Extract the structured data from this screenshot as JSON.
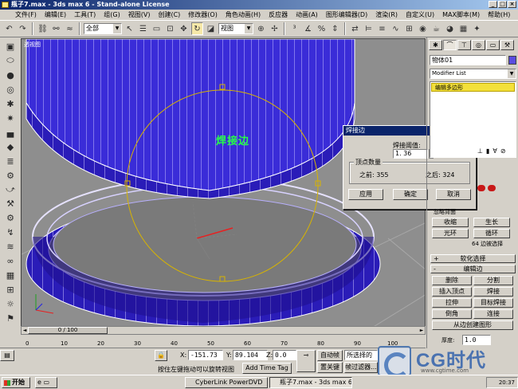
{
  "window": {
    "title": "瓶子7.max - 3ds max 6 - Stand-alone License",
    "buttons": [
      "_",
      "□",
      "×"
    ]
  },
  "menu": [
    "文件(F)",
    "编辑(E)",
    "工具(T)",
    "组(G)",
    "视图(V)",
    "创建(C)",
    "修改器(O)",
    "角色动画(H)",
    "反应器",
    "动画(A)",
    "图形编辑器(D)",
    "渲染(R)",
    "自定义(U)",
    "MAX脚本(M)",
    "帮助(H)"
  ],
  "toolbar": {
    "selection_filter": "全部",
    "coord_system": "视图"
  },
  "viewport": {
    "label": "透视图",
    "weld_label": "焊接边"
  },
  "weld_dialog": {
    "title": "焊接边",
    "threshold_label": "焊接阈值:",
    "threshold_value": "1. 36",
    "group_title": "顶点数量",
    "before": "之前: 355",
    "after": "之后: 324",
    "apply": "应用",
    "ok": "确定",
    "cancel": "取消"
  },
  "command_panel": {
    "object_name": "物体01",
    "modifier_list": "Modifier List",
    "stack_item": "编辑多边形",
    "object_color": "#5a4ce0",
    "partial_label": "忽略背面",
    "btn_shrink": "收缩",
    "btn_grow": "生长",
    "btn_ring": "光环",
    "btn_loop": "循环",
    "sel_info": "64 边被选择",
    "soft_sel": "软化选择",
    "edit_edges": "编辑边",
    "btn_remove": "删除",
    "btn_split": "分割",
    "btn_insert_vertex": "插入顶点",
    "btn_weld": "焊接",
    "btn_extrude": "拉伸",
    "btn_target_weld": "目标焊接",
    "btn_chamfer": "倒角",
    "btn_connect": "连接",
    "btn_create_shape": "从边创建图形",
    "thickness_label": "厚度:",
    "thickness_value": "1.0"
  },
  "timeline": {
    "position": "0 / 100",
    "ticks": [
      "0",
      "10",
      "20",
      "30",
      "40",
      "50",
      "60",
      "70",
      "80",
      "90",
      "100"
    ]
  },
  "status": {
    "x_label": "X:",
    "x_value": "-151.73",
    "y_label": "Y:",
    "y_value": "89.104",
    "z_label": "Z:",
    "z_value": "0.0",
    "hint": "按住左键拖动可以旋转视图",
    "add_time_tag": "Add Time Tag",
    "auto_key": "自动帧",
    "set_key": "置关键",
    "selected": "所选择的",
    "key_filters": "帧过滤器...",
    "frame": "0"
  },
  "taskbar": {
    "start": "开始",
    "items": [
      "CyberLink PowerDVD",
      "瓶子7.max - 3ds max 6 -"
    ],
    "clock": "20:37"
  },
  "watermark": {
    "brand": "CG时代",
    "url": "www.cgtime.com"
  },
  "colors": {
    "mesh": "#3a2cd8",
    "selection_circle": "#d8b400",
    "weld_label": "#27ff48",
    "stack_highlight": "#f3e03a",
    "title_gradient_start": "#0a246a"
  }
}
